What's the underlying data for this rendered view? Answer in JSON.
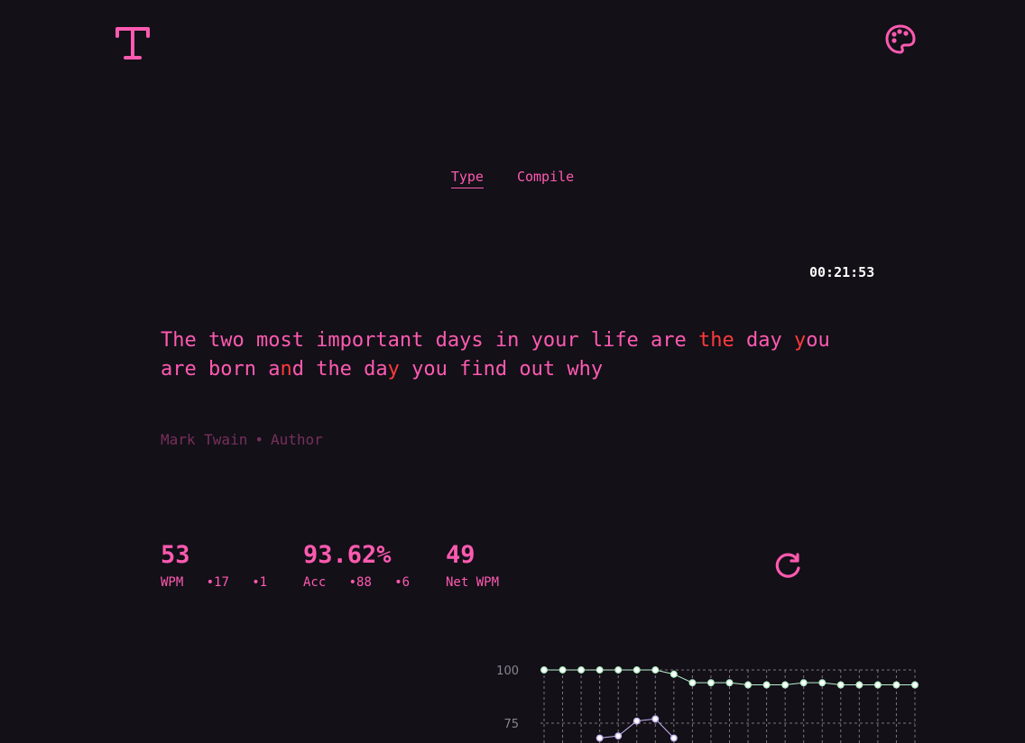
{
  "header": {
    "logo_icon": "typewriter-t-logo",
    "theme_icon": "palette-icon"
  },
  "tabs": [
    {
      "label": "Type",
      "active": true
    },
    {
      "label": "Compile",
      "active": false
    }
  ],
  "timer": "00:21:53",
  "quote": {
    "segments": [
      {
        "text": "The two most important days in your life are ",
        "error": false
      },
      {
        "text": "the",
        "error": true
      },
      {
        "text": " day ",
        "error": false
      },
      {
        "text": "y",
        "error": true
      },
      {
        "text": "ou\nare born a",
        "error": false
      },
      {
        "text": "n",
        "error": true
      },
      {
        "text": "d the da",
        "error": false
      },
      {
        "text": "y",
        "error": true
      },
      {
        "text": " you find out why",
        "error": false
      }
    ]
  },
  "attribution": {
    "author": "Mark Twain",
    "separator": "•",
    "role": "Author"
  },
  "stats": {
    "wpm": {
      "value": "53",
      "label": "WPM",
      "extra1": "•17",
      "extra2": "•1"
    },
    "accuracy": {
      "value": "93.62%",
      "label": "Acc",
      "extra1": "•88",
      "extra2": "•6"
    },
    "net_wpm": {
      "value": "49",
      "label": "Net WPM"
    }
  },
  "restart_icon": "restart-icon",
  "colors": {
    "accent": "#ff5ab0",
    "error": "#ff3b3b",
    "muted": "#76305a",
    "background": "#131018",
    "series_green": "#b8f0c8",
    "series_purple": "#c7b8f5"
  },
  "chart_data": {
    "type": "line",
    "y_ticks": [
      "100",
      "75"
    ],
    "grid": true,
    "series": [
      {
        "values": [
          100,
          100,
          100,
          100,
          100,
          100,
          100,
          98,
          94,
          94,
          94,
          93,
          93,
          93,
          94,
          94,
          93,
          93,
          93,
          93,
          93
        ]
      },
      {
        "values": [
          null,
          null,
          null,
          68,
          69,
          76,
          77,
          68
        ]
      }
    ]
  }
}
